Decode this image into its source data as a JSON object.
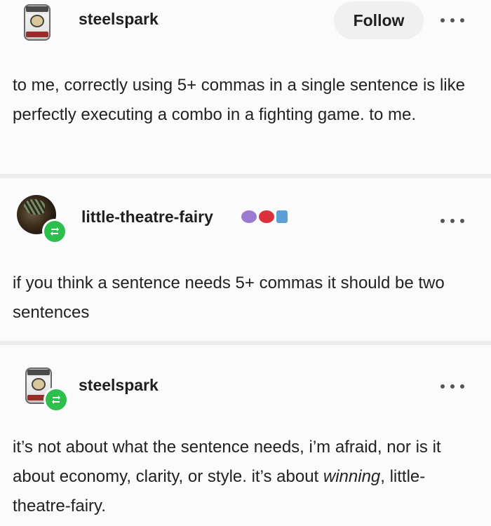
{
  "posts": [
    {
      "username": "steelspark",
      "follow_label": "Follow",
      "text": "to me, correctly using 5+ commas in a single sentence is like perfectly executing a combo in a fighting game. to me."
    },
    {
      "username": "little-theatre-fairy",
      "text": "if you think a sentence needs 5+ commas it should be two sentences",
      "badge_colors": [
        "#9b7ad1",
        "#d9303a",
        "#5aa0d6"
      ]
    },
    {
      "username": "steelspark",
      "text_part1": "it’s not about what the sentence needs, i’m afraid, nor is it about economy, clarity, or style. it’s about ",
      "text_emphasis": "winning",
      "text_part2": ", little-theatre-fairy."
    }
  ],
  "icons": {
    "more": "more-options-icon",
    "reblog": "reblog-icon"
  },
  "colors": {
    "reblog_badge": "#2cbf4b",
    "background": "#fbfbfb",
    "divider": "#ececec"
  }
}
